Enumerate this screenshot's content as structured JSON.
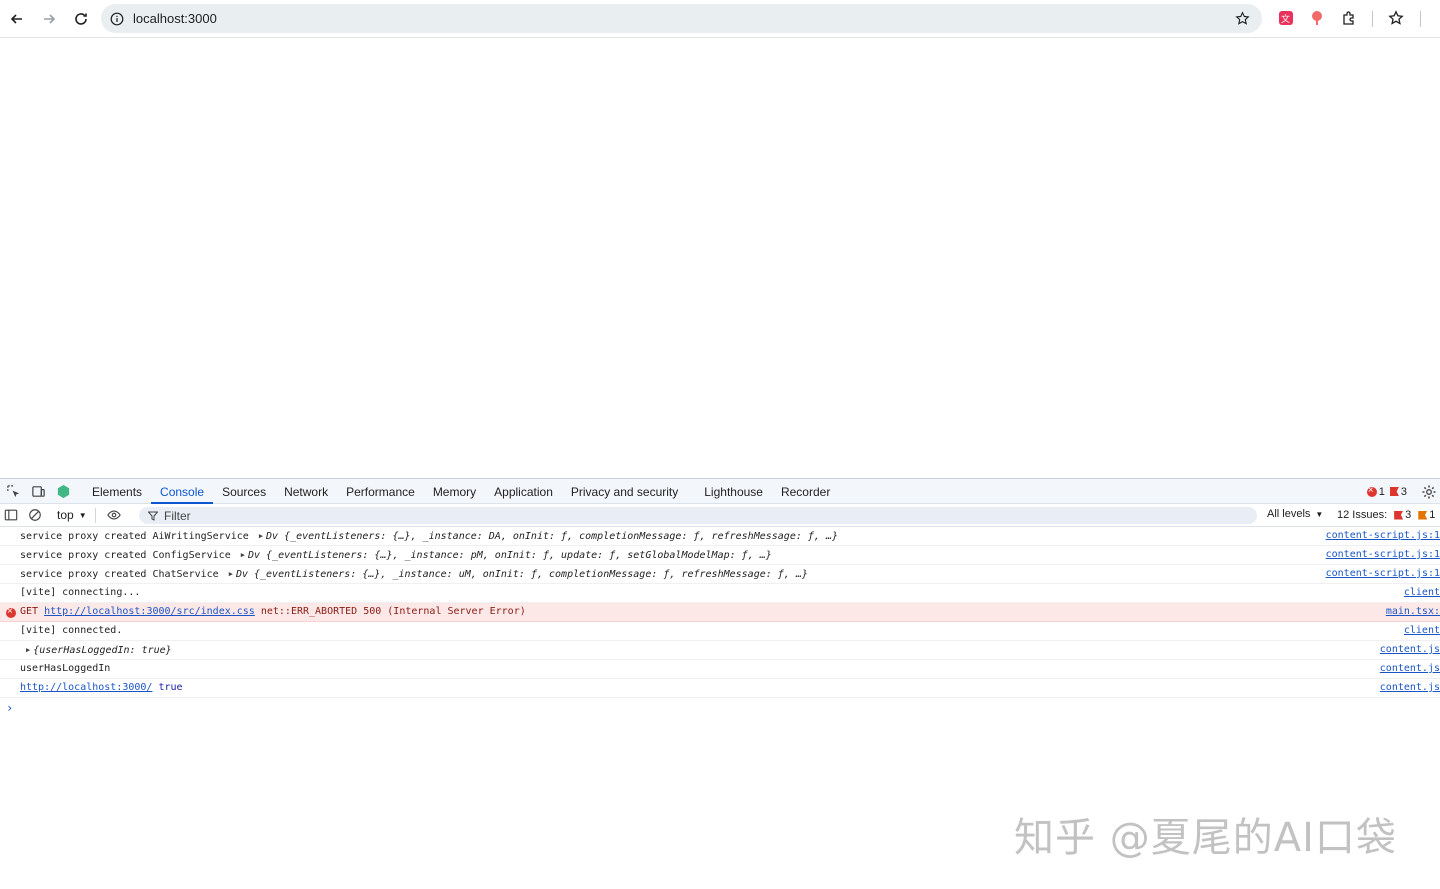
{
  "browser": {
    "url": "localhost:3000"
  },
  "devtools": {
    "tabs": [
      {
        "label": "Elements"
      },
      {
        "label": "Console"
      },
      {
        "label": "Sources"
      },
      {
        "label": "Network"
      },
      {
        "label": "Performance"
      },
      {
        "label": "Memory"
      },
      {
        "label": "Application"
      },
      {
        "label": "Privacy and security"
      },
      {
        "label": "Lighthouse"
      },
      {
        "label": "Recorder"
      }
    ],
    "active_tab": "Console",
    "error_count": "1",
    "warning_count": "3",
    "toolbar": {
      "context": "top",
      "filter_placeholder": "Filter",
      "levels": "All levels",
      "issues_label": "12 Issues:",
      "issues_red": "3",
      "issues_orange": "1"
    },
    "console": [
      {
        "prefix": "service proxy created AiWritingService",
        "obj": "Dv {_eventListeners: {…}, _instance: DA, onInit: ƒ, completionMessage: ƒ, refreshMessage: ƒ, …}",
        "src": "content-script.js:1"
      },
      {
        "prefix": "service proxy created ConfigService",
        "obj": "Dv {_eventListeners: {…}, _instance: pM, onInit: ƒ, update: ƒ, setGlobalModelMap: ƒ, …}",
        "src": "content-script.js:1"
      },
      {
        "prefix": "service proxy created ChatService",
        "obj": "Dv {_eventListeners: {…}, _instance: uM, onInit: ƒ, completionMessage: ƒ, refreshMessage: ƒ, …}",
        "src": "content-script.js:1"
      },
      {
        "text": "[vite] connecting...",
        "src": "client"
      },
      {
        "get": "GET",
        "url": "http://localhost:3000/src/index.css",
        "msg": "net::ERR_ABORTED 500 (Internal Server Error)",
        "src": "main.tsx:"
      },
      {
        "text": "[vite] connected.",
        "src": "client"
      },
      {
        "obj": "{userHasLoggedIn: true}",
        "src": "content.js"
      },
      {
        "text": "userHasLoggedIn",
        "src": "content.js"
      },
      {
        "url": "http://localhost:3000/",
        "value": "true",
        "src": "content.js"
      }
    ]
  },
  "watermark": "知乎 @夏尾的AI口袋",
  "colors": {
    "accent": "#0b57d0",
    "error": "#dc362e",
    "error_row_bg": "#fde8e8",
    "link": "#1a55c6"
  }
}
